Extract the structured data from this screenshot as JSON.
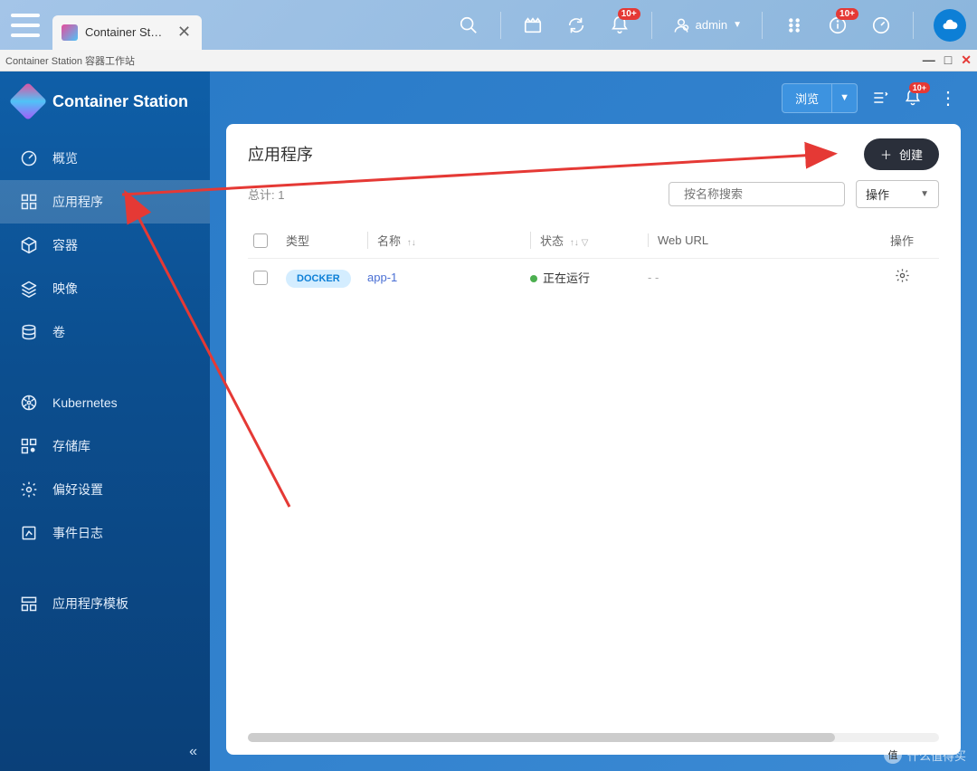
{
  "os_bar": {
    "tab_label": "Container Sta...",
    "user_name": "admin",
    "badge_bell": "10+",
    "badge_info": "10+"
  },
  "window": {
    "title": "Container Station 容器工作站"
  },
  "app": {
    "brand": "Container Station",
    "nav": {
      "overview": "概览",
      "applications": "应用程序",
      "containers": "容器",
      "images": "映像",
      "volumes": "卷",
      "kubernetes": "Kubernetes",
      "storage": "存储库",
      "preferences": "偏好设置",
      "eventlog": "事件日志",
      "templates": "应用程序模板"
    },
    "header": {
      "browse_label": "浏览",
      "notif_badge": "10+"
    },
    "panel": {
      "title": "应用程序",
      "total_label": "总计: 1",
      "search_placeholder": "按名称搜索",
      "action_label": "操作",
      "create_label": "创建",
      "columns": {
        "type": "类型",
        "name": "名称",
        "status": "状态",
        "weburl": "Web URL",
        "ops": "操作"
      },
      "rows": [
        {
          "type_badge": "DOCKER",
          "name": "app-1",
          "status": "正在运行",
          "url": "- -"
        }
      ]
    }
  },
  "watermark": "什么值得买"
}
